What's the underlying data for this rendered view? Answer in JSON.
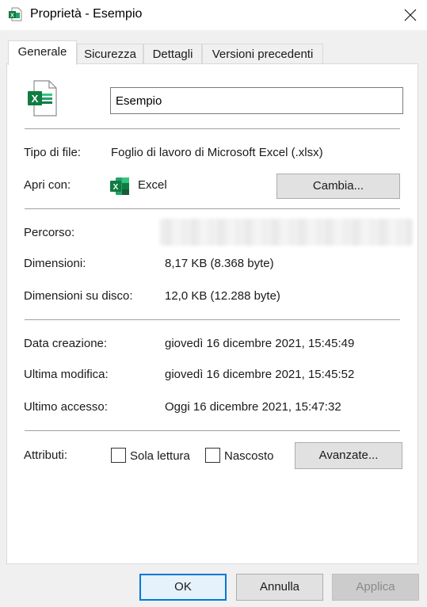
{
  "window": {
    "title": "Proprietà - Esempio",
    "app_icon": "excel-file-icon",
    "close_icon": "close-icon"
  },
  "tabs": [
    {
      "label": "Generale",
      "active": true
    },
    {
      "label": "Sicurezza",
      "active": false
    },
    {
      "label": "Dettagli",
      "active": false
    },
    {
      "label": "Versioni precedenti",
      "active": false
    }
  ],
  "general": {
    "file_icon": "excel-file-icon",
    "file_name": "Esempio",
    "file_type_label": "Tipo di file:",
    "file_type_value": "Foglio di lavoro di Microsoft Excel (.xlsx)",
    "open_with_label": "Apri con:",
    "open_with_app": "Excel",
    "open_with_icon": "excel-icon",
    "change_button": "Cambia...",
    "location_label": "Percorso:",
    "size_label": "Dimensioni:",
    "size_value": "8,17 KB (8.368 byte)",
    "size_on_disk_label": "Dimensioni su disco:",
    "size_on_disk_value": "12,0 KB (12.288 byte)",
    "created_label": "Data creazione:",
    "created_value": "giovedì 16 dicembre 2021, 15:45:49",
    "modified_label": "Ultima modifica:",
    "modified_value": "giovedì 16 dicembre 2021, 15:45:52",
    "accessed_label": "Ultimo accesso:",
    "accessed_value": "Oggi 16 dicembre 2021, 15:47:32",
    "attributes_label": "Attributi:",
    "readonly_label": "Sola lettura",
    "readonly_checked": false,
    "hidden_label": "Nascosto",
    "hidden_checked": false,
    "advanced_button": "Avanzate..."
  },
  "footer": {
    "ok": "OK",
    "cancel": "Annulla",
    "apply": "Applica"
  },
  "colors": {
    "excel_green": "#107c41",
    "focus_blue": "#0078d7"
  }
}
